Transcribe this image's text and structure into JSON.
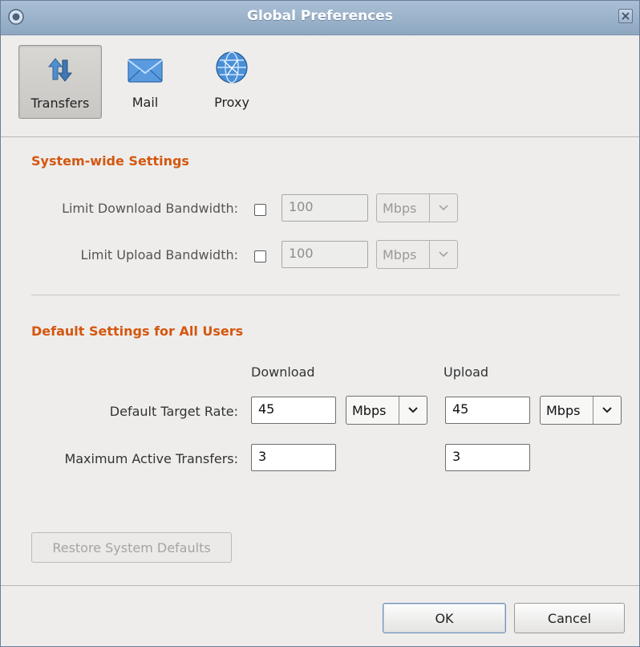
{
  "window": {
    "title": "Global Preferences"
  },
  "toolbar": {
    "items": [
      {
        "label": "Transfers",
        "icon": "transfers-arrows-icon",
        "active": true
      },
      {
        "label": "Mail",
        "icon": "mail-envelope-icon",
        "active": false
      },
      {
        "label": "Proxy",
        "icon": "proxy-globe-icon",
        "active": false
      }
    ]
  },
  "system": {
    "heading": "System-wide Settings",
    "download": {
      "label": "Limit Download Bandwidth:",
      "checked": false,
      "value": "100",
      "unit": "Mbps"
    },
    "upload": {
      "label": "Limit Upload Bandwidth:",
      "checked": false,
      "value": "100",
      "unit": "Mbps"
    }
  },
  "defaults": {
    "heading": "Default Settings for All Users",
    "col_download": "Download",
    "col_upload": "Upload",
    "target_rate": {
      "label": "Default Target Rate:",
      "download_value": "45",
      "download_unit": "Mbps",
      "upload_value": "45",
      "upload_unit": "Mbps"
    },
    "max_active": {
      "label": "Maximum Active Transfers:",
      "download_value": "3",
      "upload_value": "3"
    }
  },
  "buttons": {
    "restore": "Restore System Defaults",
    "ok": "OK",
    "cancel": "Cancel"
  },
  "colors": {
    "section_heading": "#d4570f",
    "titlebar": "#9db4cc"
  }
}
